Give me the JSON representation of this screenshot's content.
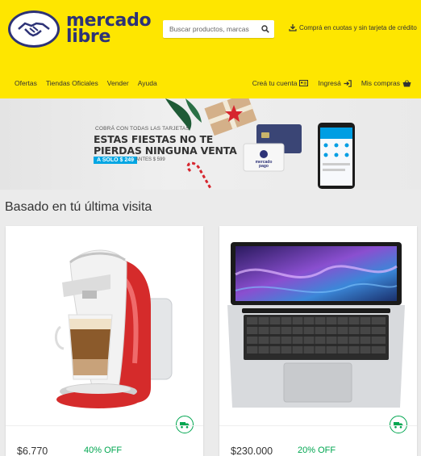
{
  "header": {
    "logo": {
      "line1": "mercado",
      "line2": "libre"
    },
    "search_placeholder": "Buscar productos, marcas",
    "promo": "Comprá en cuotas y sin tarjeta de crédito",
    "nav_left": [
      "Ofertas",
      "Tiendas Oficiales",
      "Vender",
      "Ayuda"
    ],
    "nav_right": {
      "create_account": "Creá tu cuenta",
      "login": "Ingresá",
      "purchases": "Mis compras"
    }
  },
  "banner": {
    "small": "COBRÁ CON TODAS LAS TARJETAS",
    "line1": "ESTAS FIESTAS NO TE",
    "line2": "PIERDAS NINGUNA VENTA",
    "badge": "A SOLO $ 249",
    "before": "ANTES $ 599",
    "card_logo": "mercado pago"
  },
  "section": {
    "title": "Basado en tú última visita"
  },
  "products": [
    {
      "price": "$6.770",
      "off": "40% OFF"
    },
    {
      "price": "$230.000",
      "off": "20% OFF"
    }
  ],
  "colors": {
    "yellow": "#fee600",
    "brand_blue": "#2d3277",
    "green": "#00a650",
    "blue": "#00a6e3"
  }
}
